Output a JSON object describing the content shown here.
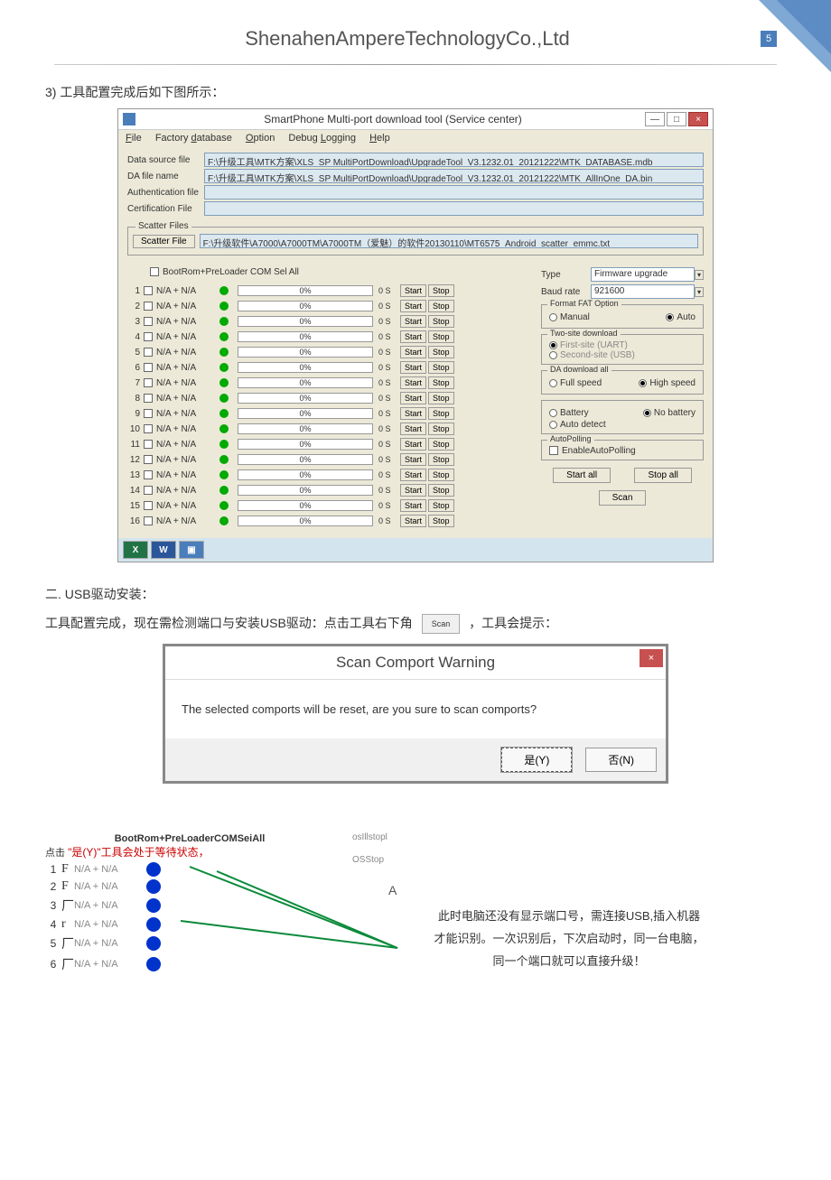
{
  "header": {
    "company": "ShenahenAmpereTechnologyCo.,Ltd",
    "page": "5"
  },
  "step3": "3) 工具配置完成后如下图所示：",
  "win": {
    "title": "SmartPhone Multi-port download tool (Service center)",
    "menu": {
      "file": "File",
      "factory": "Factory database",
      "option": "Option",
      "debug": "Debug Logging",
      "help": "Help"
    },
    "rows": {
      "datasource": {
        "label": "Data source file",
        "value": "F:\\升级工具\\MTK方案\\XLS_SP MultiPortDownload\\UpgradeTool_V3.1232.01_20121222\\MTK_DATABASE.mdb"
      },
      "dafile": {
        "label": "DA file name",
        "value": "F:\\升级工具\\MTK方案\\XLS_SP MultiPortDownload\\UpgradeTool_V3.1232.01_20121222\\MTK_AllInOne_DA.bin"
      },
      "auth": {
        "label": "Authentication file",
        "value": ""
      },
      "cert": {
        "label": "Certification File",
        "value": ""
      }
    },
    "scatter": {
      "legend": "Scatter Files",
      "btn": "Scatter File",
      "value": "F:\\升级软件\\A7000\\A7000TM\\A7000TM（爱魅）的软件20130110\\MT6575_Android_scatter_emmc.txt"
    },
    "portsHeader": "BootRom+PreLoader COM Sel All",
    "ports": [
      {
        "n": "1",
        "na": "N/A + N/A",
        "pct": "0%",
        "t": "0 S"
      },
      {
        "n": "2",
        "na": "N/A + N/A",
        "pct": "0%",
        "t": "0 S"
      },
      {
        "n": "3",
        "na": "N/A + N/A",
        "pct": "0%",
        "t": "0 S"
      },
      {
        "n": "4",
        "na": "N/A + N/A",
        "pct": "0%",
        "t": "0 S"
      },
      {
        "n": "5",
        "na": "N/A + N/A",
        "pct": "0%",
        "t": "0 S"
      },
      {
        "n": "6",
        "na": "N/A + N/A",
        "pct": "0%",
        "t": "0 S"
      },
      {
        "n": "7",
        "na": "N/A + N/A",
        "pct": "0%",
        "t": "0 S"
      },
      {
        "n": "8",
        "na": "N/A + N/A",
        "pct": "0%",
        "t": "0 S"
      },
      {
        "n": "9",
        "na": "N/A + N/A",
        "pct": "0%",
        "t": "0 S"
      },
      {
        "n": "10",
        "na": "N/A + N/A",
        "pct": "0%",
        "t": "0 S"
      },
      {
        "n": "11",
        "na": "N/A + N/A",
        "pct": "0%",
        "t": "0 S"
      },
      {
        "n": "12",
        "na": "N/A + N/A",
        "pct": "0%",
        "t": "0 S"
      },
      {
        "n": "13",
        "na": "N/A + N/A",
        "pct": "0%",
        "t": "0 S"
      },
      {
        "n": "14",
        "na": "N/A + N/A",
        "pct": "0%",
        "t": "0 S"
      },
      {
        "n": "15",
        "na": "N/A + N/A",
        "pct": "0%",
        "t": "0 S"
      },
      {
        "n": "16",
        "na": "N/A + N/A",
        "pct": "0%",
        "t": "0 S"
      }
    ],
    "portBtns": {
      "start": "Start",
      "stop": "Stop"
    },
    "side": {
      "type": {
        "label": "Type",
        "value": "Firmware upgrade"
      },
      "baud": {
        "label": "Baud rate",
        "value": "921600"
      },
      "fat": {
        "legend": "Format FAT Option",
        "manual": "Manual",
        "auto": "Auto"
      },
      "twosite": {
        "legend": "Two-site download",
        "first": "First-site (UART)",
        "second": "Second-site (USB)"
      },
      "da": {
        "legend": "DA download all",
        "full": "Full speed",
        "high": "High speed"
      },
      "batt": {
        "battery": "Battery",
        "nobatt": "No battery",
        "auto": "Auto detect"
      },
      "poll": {
        "legend": "AutoPolling",
        "enable": "EnableAutoPolling"
      },
      "btns": {
        "startall": "Start all",
        "stopall": "Stop all",
        "scan": "Scan"
      }
    }
  },
  "section2": "二. USB驱动安装：",
  "para1": {
    "a": "工具配置完成，现在需检测端口与安装USB驱动：点击工具右下角",
    "scan": "Scan",
    "b": "，工具会提示：",
    "click": "点击"
  },
  "dialog": {
    "title": "Scan Comport Warning",
    "body": "The selected comports will be reset, are you sure to scan comports?",
    "yes": "是(Y)",
    "no": "否(N)"
  },
  "bottom": {
    "hdr": "BootRom+PreLoaderCOMSeiAll",
    "redtxt": "\"是(Y)\"工具会处于等待状态，",
    "rows": [
      {
        "n": "1",
        "f": "F",
        "t": "N/A + N/A"
      },
      {
        "n": "2",
        "f": "F",
        "t": "N/A + N/A"
      },
      {
        "n": "3",
        "f": "厂",
        "t": "N/A + N/A"
      },
      {
        "n": "4",
        "f": "r",
        "t": "N/A + N/A"
      },
      {
        "n": "5",
        "f": "厂",
        "t": "N/A + N/A"
      },
      {
        "n": "6",
        "f": "厂",
        "t": "N/A + N/A"
      }
    ],
    "anno1": "osIllstopl",
    "anno2": "OSStop",
    "anno3": "A",
    "rtext1": "此时电脑还没有显示端口号，需连接USB,插入机器",
    "rtext2": "才能识别。一次识别后，下次启动时，同一台电脑，",
    "rtext3": "同一个端口就可以直接升级！"
  }
}
